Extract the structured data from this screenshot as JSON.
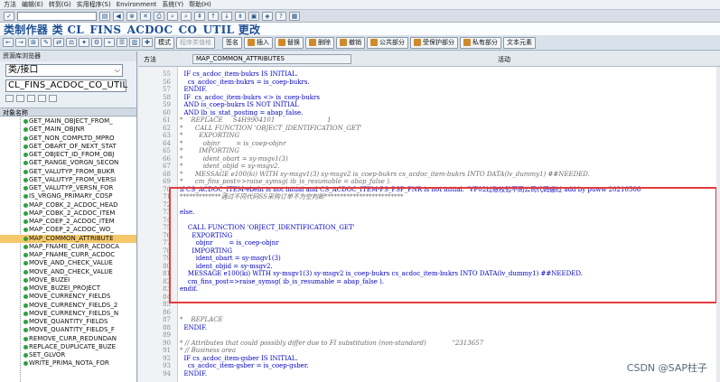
{
  "menu": {
    "items": [
      "方法",
      "编辑(E)",
      "转到(G)",
      "实用程序(S)",
      "Environment",
      "系统(Y)",
      "帮助(H)"
    ]
  },
  "title": "类制作器 类 CL_FINS_ACDOC_CO_UTIL 更改",
  "toolbar": {
    "buttons": [
      "模式",
      "程序类值格",
      "签名",
      "插入",
      "替换",
      "删除",
      "撤销",
      "公共部分",
      "受保护部分",
      "私有部分",
      "文本元素"
    ]
  },
  "left": {
    "header": "资源库浏览器",
    "type_select": "类/接口",
    "object_name": "CL_FINS_ACDOC_CO_UTIL",
    "col_header": "对象名称",
    "items": [
      "GET_MAIN_OBJECT_FROM_",
      "GET_MAIN_OBJNR",
      "GET_NON_COMPLTD_MPRO",
      "GET_OBART_OF_NEXT_STAT",
      "GET_OBJECT_ID_FROM_OBJ",
      "GET_RANGE_VORGN_SECON",
      "GET_VALUTYP_FROM_BUKR",
      "GET_VALUTYP_FROM_VERSI",
      "GET_VALUTYP_VERSN_FOR",
      "IS_VRGNG_PRIMARY_COSP",
      "MAP_COBK_2_ACDOC_HEAD",
      "MAP_COBK_2_ACDOC_ITEM",
      "MAP_COEP_2_ACDOC_ITEM",
      "MAP_COEP_2_ACDOC_WO_",
      "MAP_COMMON_ATTRIBUTE",
      "MAP_FNAME_CURR_ACDOCA",
      "MAP_FNAME_CURR_ACDOC",
      "MOVE_AND_CHECK_VALUE",
      "MOVE_AND_CHECK_VALUE",
      "MOVE_BUZEI",
      "MOVE_BUZEI_PROJECT",
      "MOVE_CURRENCY_FIELDS",
      "MOVE_CURRENCY_FIELDS_2",
      "MOVE_CURRENCY_FIELDS_N",
      "MOVE_QUANTITY_FIELDS",
      "MOVE_QUANTITY_FIELDS_F",
      "REMOVE_CURR_REDUNDAN",
      "REPLACE_DUPLICATE_BUZE",
      "SET_GLVOR",
      "WRITE_PRIMA_NOTA_FOR"
    ],
    "selected_index": 14
  },
  "editor": {
    "method_label": "方法",
    "method_name": "MAP_COMMON_ATTRIBUTES",
    "status": "活动",
    "lines": [
      {
        "no": "55",
        "t": "  IF cs_acdoc_item-bukrs IS INITIAL.",
        "c": false
      },
      {
        "no": "56",
        "t": "    cs_acdoc_item-bukrs = is_coep-bukrs.",
        "c": false
      },
      {
        "no": "57",
        "t": "  ENDIF.",
        "c": false
      },
      {
        "no": "58",
        "t": "  IF  cs_acdoc_item-bukrs <> is_coep-bukrs",
        "c": false
      },
      {
        "no": "59",
        "t": "  AND is_coep-bukrs IS NOT INITIAL",
        "c": false
      },
      {
        "no": "60",
        "t": "  AND lb_is_stat_posting = abap_false.",
        "c": false
      },
      {
        "no": "61",
        "t": "*    REPLACE     S4H9904101                          1",
        "c": true
      },
      {
        "no": "62",
        "t": "*      CALL FUNCTION 'OBJECT_IDENTIFICATION_GET'",
        "c": true
      },
      {
        "no": "63",
        "t": "*        EXPORTING",
        "c": true
      },
      {
        "no": "64",
        "t": "*          objnr        = is_coep-objnr",
        "c": true
      },
      {
        "no": "65",
        "t": "*        IMPORTING",
        "c": true
      },
      {
        "no": "66",
        "t": "*          ident_obart = sy-msgv1(3)",
        "c": true
      },
      {
        "no": "67",
        "t": "*          ident_objid = sy-msgv2.",
        "c": true
      },
      {
        "no": "68",
        "t": "*      MESSAGE e100(ki) WITH sy-msgv1(3) sy-msgv2 is_coep-bukrs cs_acdoc_item-bukrs INTO DATA(lv_dummy1) ##NEEDED.",
        "c": true
      },
      {
        "no": "69",
        "t": "*      cm_fins_post=>raise_symsg( ib_is_resumable = abap_false ).",
        "c": true
      },
      {
        "no": "70",
        "t": "if CS_ACDOC_ITEM-ebeln is not initial and CS_ACDOC_ITEM-PS_PSP_PNR is not initial. \"VF02过账校验不同公司代码通过 add by puww 20210506",
        "c": false
      },
      {
        "no": "71",
        "t": "*************通过不同代码SS采购订单不为空判断*************************",
        "c": true
      },
      {
        "no": "72",
        "t": "",
        "c": false
      },
      {
        "no": "73",
        "t": "else.",
        "c": false
      },
      {
        "no": "74",
        "t": "",
        "c": false
      },
      {
        "no": "75",
        "t": "    CALL FUNCTION 'OBJECT_IDENTIFICATION_GET'",
        "c": false
      },
      {
        "no": "76",
        "t": "      EXPORTING",
        "c": false
      },
      {
        "no": "77",
        "t": "        objnr        = is_coep-objnr",
        "c": false
      },
      {
        "no": "78",
        "t": "      IMPORTING",
        "c": false
      },
      {
        "no": "79",
        "t": "        ident_obart = sy-msgv1(3)",
        "c": false
      },
      {
        "no": "80",
        "t": "        ident_objid = sy-msgv2.",
        "c": false
      },
      {
        "no": "81",
        "t": "    MESSAGE e100(ki) WITH sy-msgv1(3) sy-msgv2 is_coep-bukrs cs_acdoc_item-bukrs INTO DATA(lv_dummy1) ##NEEDED.",
        "c": false
      },
      {
        "no": "82",
        "t": "    cm_fins_post=>raise_symsg( ib_is_resumable = abap_false ).",
        "c": false
      },
      {
        "no": "83",
        "t": "endif.",
        "c": false
      },
      {
        "no": "84",
        "t": "",
        "c": false
      },
      {
        "no": "85",
        "t": "",
        "c": false
      },
      {
        "no": "86",
        "t": "",
        "c": false
      },
      {
        "no": "87",
        "t": "*    REPLACE",
        "c": true
      },
      {
        "no": "88",
        "t": "  ENDIF.",
        "c": false
      },
      {
        "no": "89",
        "t": "",
        "c": false
      },
      {
        "no": "90",
        "t": "* // Attributes that could possibly differ due to FI substitution (non-standard)             \"2313657",
        "c": true
      },
      {
        "no": "91",
        "t": "* // Business area",
        "c": true
      },
      {
        "no": "92",
        "t": "  IF cs_acdoc_item-gsber IS INITIAL.",
        "c": false
      },
      {
        "no": "93",
        "t": "    cs_acdoc_item-gsber = is_coep-gsber.",
        "c": false
      },
      {
        "no": "94",
        "t": "  ENDIF.",
        "c": false
      }
    ]
  },
  "watermark": "CSDN @SAP柱子"
}
